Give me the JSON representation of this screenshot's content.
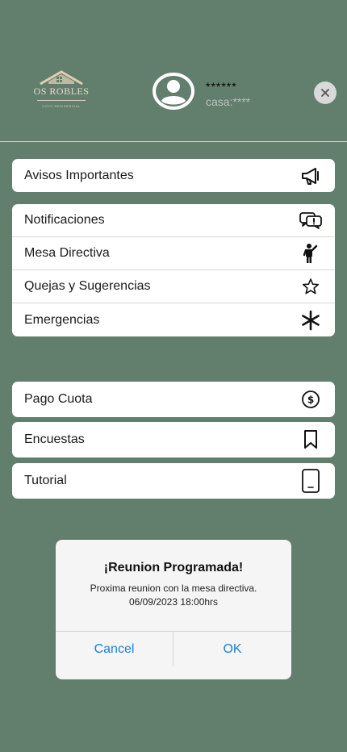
{
  "header": {
    "logo_text": "OS ROBLES",
    "logo_subtext": "COTO RESIDENCIAL",
    "user_name": "******",
    "user_house": "casa:****"
  },
  "menu_groups": [
    {
      "items": [
        {
          "label": "Avisos Importantes",
          "icon": "megaphone-icon"
        }
      ]
    },
    {
      "items": [
        {
          "label": "Notificaciones",
          "icon": "chat-alert-icon"
        },
        {
          "label": "Mesa Directiva",
          "icon": "person-icon"
        },
        {
          "label": "Quejas y Sugerencias",
          "icon": "star-icon"
        },
        {
          "label": "Emergencias",
          "icon": "asterisk-icon"
        }
      ]
    },
    {
      "items": [
        {
          "label": "Pago Cuota",
          "icon": "dollar-circle-icon"
        }
      ]
    },
    {
      "items": [
        {
          "label": "Encuestas",
          "icon": "bookmark-icon"
        }
      ]
    },
    {
      "items": [
        {
          "label": "Tutorial",
          "icon": "phone-icon"
        }
      ]
    }
  ],
  "dialog": {
    "title": "¡Reunion Programada!",
    "message_line1": "Proxima reunion con la mesa directiva.",
    "message_line2": "06/09/2023 18:00hrs",
    "cancel_label": "Cancel",
    "ok_label": "OK"
  },
  "colors": {
    "background": "#627f6d",
    "accent": "#1a7fdc",
    "logo": "#e9dccb"
  }
}
